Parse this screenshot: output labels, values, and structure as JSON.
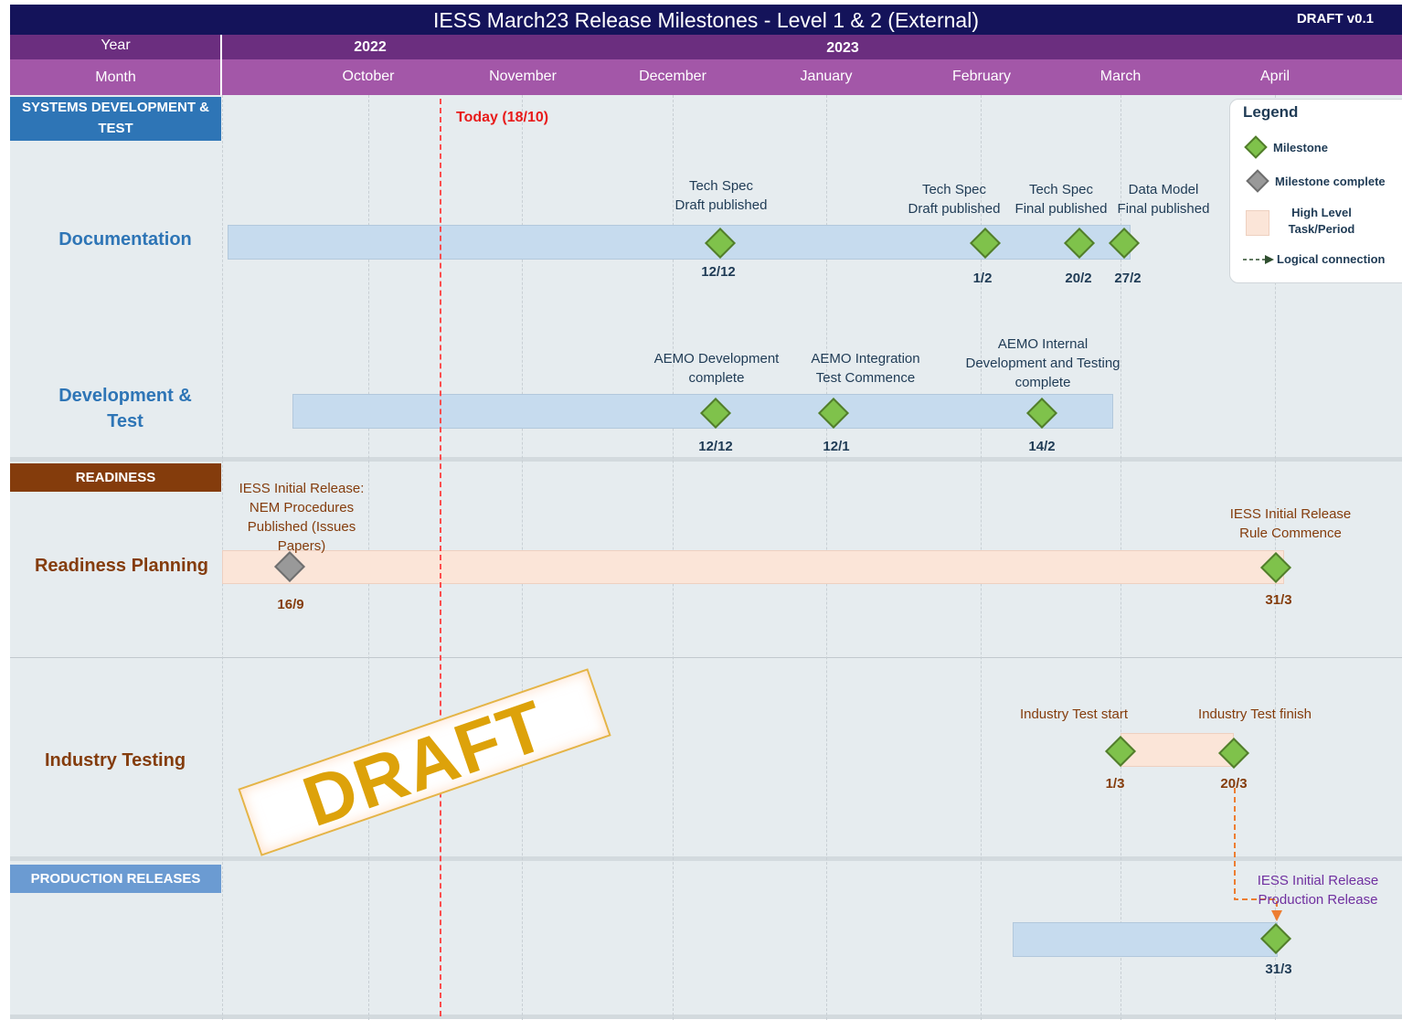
{
  "title": "IESS March23 Release Milestones - Level 1 & 2 (External)",
  "draft_version": "DRAFT v0.1",
  "timeline": {
    "year_label": "Year",
    "month_label": "Month",
    "years": [
      "2022",
      "2023"
    ],
    "months": [
      "October",
      "November",
      "December",
      "January",
      "February",
      "March",
      "April"
    ]
  },
  "today_marker": "Today (18/10)",
  "sections": {
    "systems": "SYSTEMS DEVELOPMENT & TEST",
    "readiness": "READINESS",
    "production": "PRODUCTION RELEASES"
  },
  "rows": {
    "documentation": {
      "label": "Documentation",
      "milestones": [
        {
          "label": "Tech Spec\nDraft published",
          "date": "12/12",
          "status": "milestone"
        },
        {
          "label": "Tech Spec\nDraft published",
          "date": "1/2",
          "status": "milestone"
        },
        {
          "label": "Tech Spec\nFinal published",
          "date": "20/2",
          "status": "milestone"
        },
        {
          "label": "Data Model\nFinal published",
          "date": "27/2",
          "status": "milestone"
        }
      ]
    },
    "development": {
      "label": "Development & Test",
      "milestones": [
        {
          "label": "AEMO Development\ncomplete",
          "date": "12/12",
          "status": "milestone"
        },
        {
          "label": "AEMO Integration\nTest Commence",
          "date": "12/1",
          "status": "milestone"
        },
        {
          "label": "AEMO Internal\nDevelopment and Testing\ncomplete",
          "date": "14/2",
          "status": "milestone"
        }
      ]
    },
    "readiness_planning": {
      "label": "Readiness Planning",
      "milestones": [
        {
          "label": "IESS Initial Release:\nNEM Procedures\nPublished (Issues\nPapers)",
          "date": "16/9",
          "status": "complete"
        },
        {
          "label": "IESS Initial Release\nRule Commence",
          "date": "31/3",
          "status": "milestone"
        }
      ]
    },
    "industry_testing": {
      "label": "Industry Testing",
      "milestones": [
        {
          "label": "Industry Test start",
          "date": "1/3",
          "status": "milestone"
        },
        {
          "label": "Industry Test finish",
          "date": "20/3",
          "status": "milestone"
        }
      ]
    },
    "production": {
      "milestones": [
        {
          "label": "IESS Initial Release\nProduction Release",
          "date": "31/3",
          "status": "milestone"
        }
      ]
    }
  },
  "legend": {
    "title": "Legend",
    "items": [
      "Milestone",
      "Milestone complete",
      "High Level\nTask/Period",
      "Logical connection"
    ]
  },
  "watermark": "DRAFT",
  "colors": {
    "title_bg": "#14135a",
    "year_bg": "#6b2e7f",
    "month_bg": "#a357a8",
    "systems_header": "#2e75b6",
    "readiness_header": "#843c0c",
    "production_header": "#6b9bd2",
    "documentation_text": "#2e75b6",
    "readiness_text": "#843c0c",
    "milestone": "#7fc24b",
    "milestone_complete": "#999999",
    "today": "#e81b1b",
    "connector": "#ed7d31",
    "production_text": "#7030a0"
  }
}
